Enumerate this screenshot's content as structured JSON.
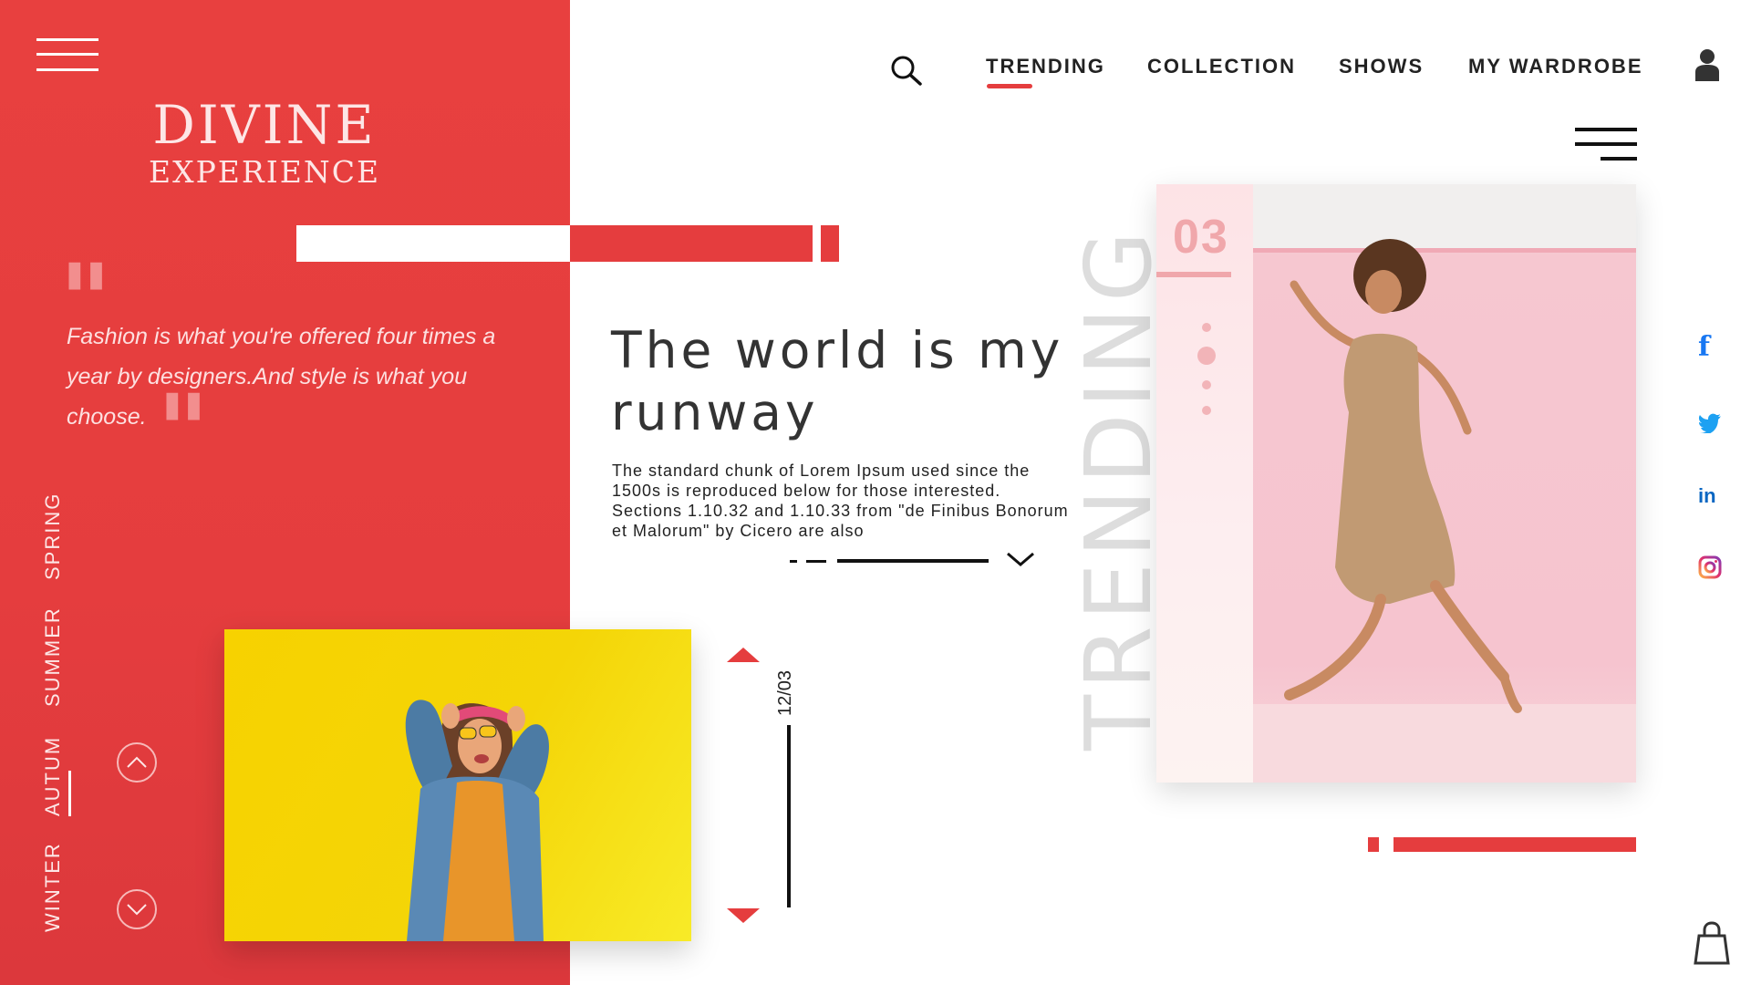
{
  "brand": {
    "line1": "DIVINE",
    "line2": "EXPERIENCE"
  },
  "quote": {
    "open_mark": "\"",
    "text": "Fashion is what you're offered four times  a year by designers.And style is what you choose.",
    "close_mark": "\""
  },
  "seasons": [
    "SPRING",
    "SUMMER",
    "AUTUM",
    "WINTER"
  ],
  "active_season": "AUTUM",
  "nav": {
    "items": [
      "TRENDING",
      "COLLECTION",
      "SHOWS",
      "MY WARDROBE"
    ],
    "active": "TRENDING"
  },
  "hero": {
    "headline": "The world is my runway",
    "body": "The standard chunk of Lorem Ipsum used since the 1500s is reproduced below for those interested. Sections 1.10.32 and 1.10.33 from \"de Finibus Bonorum et Malorum\" by Cicero are also"
  },
  "slider": {
    "counter": "12/03"
  },
  "trending": {
    "vertical_label": "TRENDING",
    "card_number": "03"
  },
  "social": {
    "facebook": "f",
    "linkedin": "in"
  },
  "colors": {
    "accent": "#e53d3e",
    "light_pink": "#f0a7ab",
    "yellow": "#f7d200"
  },
  "icons": [
    "menu-icon",
    "search-icon",
    "user-icon",
    "facebook-icon",
    "twitter-icon",
    "linkedin-icon",
    "instagram-icon",
    "shopping-bag-icon",
    "chevron-up-icon",
    "chevron-down-icon"
  ]
}
